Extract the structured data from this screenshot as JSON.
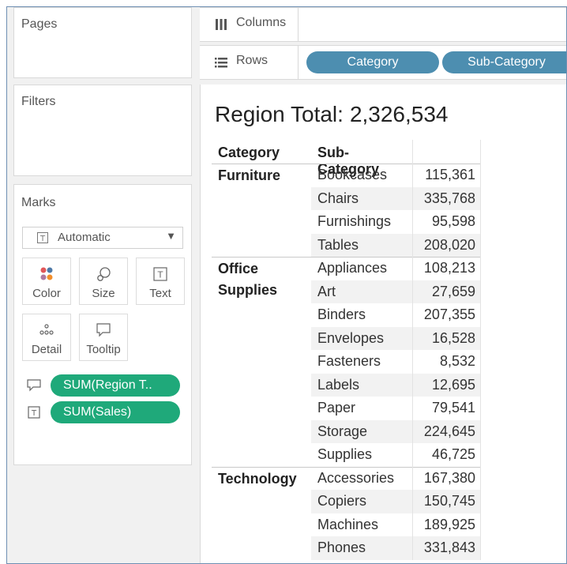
{
  "left_panel": {
    "pages": {
      "title": "Pages"
    },
    "filters": {
      "title": "Filters"
    },
    "marks": {
      "title": "Marks",
      "mark_type": "Automatic",
      "buttons": [
        {
          "label": "Color",
          "icon": "color-dots-icon"
        },
        {
          "label": "Size",
          "icon": "size-icon"
        },
        {
          "label": "Text",
          "icon": "text-icon"
        },
        {
          "label": "Detail",
          "icon": "detail-icon"
        },
        {
          "label": "Tooltip",
          "icon": "tooltip-icon"
        }
      ],
      "fields": [
        {
          "icon": "tooltip-icon",
          "label": "SUM(Region T.."
        },
        {
          "icon": "text-icon",
          "label": "SUM(Sales)"
        }
      ]
    }
  },
  "shelves": {
    "columns": {
      "label": "Columns",
      "icon": "columns-icon",
      "pills": []
    },
    "rows": {
      "label": "Rows",
      "icon": "rows-icon",
      "pills": [
        "Category",
        "Sub-Category"
      ]
    }
  },
  "view": {
    "title_label": "Region Total:",
    "title_value": "2,326,534",
    "table": {
      "headers": [
        "Category",
        "Sub-Category"
      ],
      "groups": [
        {
          "category_lines": [
            "Furniture"
          ],
          "rows": [
            {
              "sub": "Bookcases",
              "value": "115,361"
            },
            {
              "sub": "Chairs",
              "value": "335,768"
            },
            {
              "sub": "Furnishings",
              "value": "95,598"
            },
            {
              "sub": "Tables",
              "value": "208,020"
            }
          ]
        },
        {
          "category_lines": [
            "Office",
            "Supplies"
          ],
          "rows": [
            {
              "sub": "Appliances",
              "value": "108,213"
            },
            {
              "sub": "Art",
              "value": "27,659"
            },
            {
              "sub": "Binders",
              "value": "207,355"
            },
            {
              "sub": "Envelopes",
              "value": "16,528"
            },
            {
              "sub": "Fasteners",
              "value": "8,532"
            },
            {
              "sub": "Labels",
              "value": "12,695"
            },
            {
              "sub": "Paper",
              "value": "79,541"
            },
            {
              "sub": "Storage",
              "value": "224,645"
            },
            {
              "sub": "Supplies",
              "value": "46,725"
            }
          ]
        },
        {
          "category_lines": [
            "Technology"
          ],
          "rows": [
            {
              "sub": "Accessories",
              "value": "167,380"
            },
            {
              "sub": "Copiers",
              "value": "150,745"
            },
            {
              "sub": "Machines",
              "value": "189,925"
            },
            {
              "sub": "Phones",
              "value": "331,843"
            }
          ]
        }
      ]
    }
  },
  "colors": {
    "shelf_pill": "#4d8eb0",
    "measure_pill": "#1fa97a",
    "frame_border": "#6e8fb3"
  }
}
